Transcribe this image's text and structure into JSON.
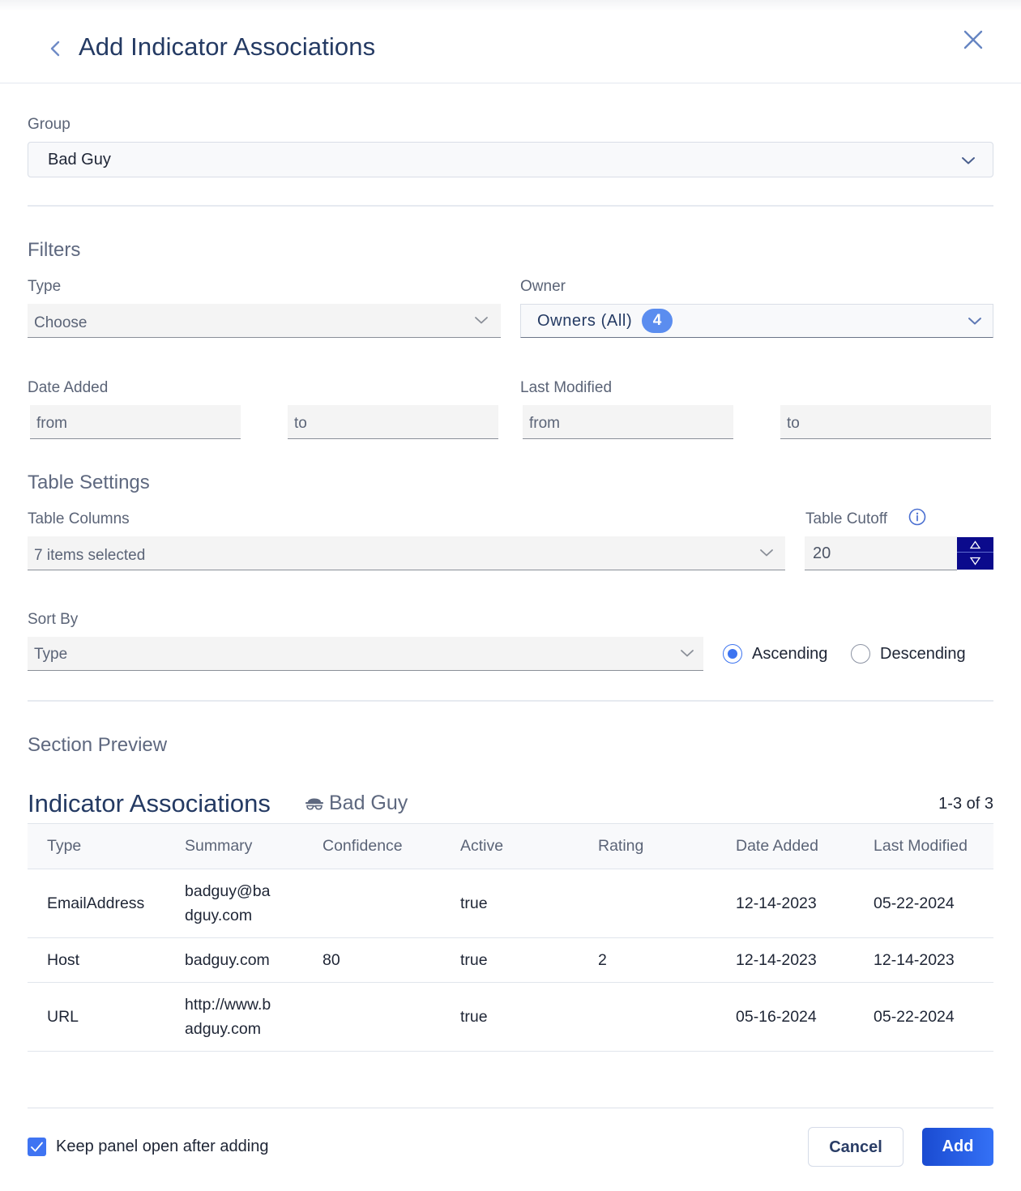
{
  "header": {
    "title": "Add Indicator Associations",
    "back_icon": "chevron-left-icon",
    "close_icon": "close-icon"
  },
  "group": {
    "label": "Group",
    "value": "Bad Guy"
  },
  "filters": {
    "title": "Filters",
    "type": {
      "label": "Type",
      "value": "Choose"
    },
    "owner": {
      "label": "Owner",
      "value": "Owners (All)",
      "count": "4"
    },
    "date_added": {
      "label": "Date Added",
      "from_placeholder": "from",
      "to_placeholder": "to"
    },
    "last_modified": {
      "label": "Last Modified",
      "from_placeholder": "from",
      "to_placeholder": "to"
    }
  },
  "table_settings": {
    "title": "Table Settings",
    "columns": {
      "label": "Table Columns",
      "value": "7 items selected"
    },
    "cutoff": {
      "label": "Table Cutoff",
      "value": "20",
      "info_icon": "info-icon"
    },
    "sort_by": {
      "label": "Sort By",
      "value": "Type"
    },
    "order": {
      "options": [
        "Ascending",
        "Descending"
      ],
      "selected": "Ascending"
    }
  },
  "preview": {
    "section_title": "Section Preview",
    "title": "Indicator Associations",
    "group_name": "Bad Guy",
    "group_icon": "spy-hat-icon",
    "pager": "1-3 of 3",
    "columns": [
      "Type",
      "Summary",
      "Confidence",
      "Active",
      "Rating",
      "Date Added",
      "Last Modified"
    ],
    "rows": [
      {
        "type": "EmailAddress",
        "summary": "badguy@badguy.com",
        "confidence": "",
        "active": "true",
        "rating": "",
        "date_added": "12-14-2023",
        "last_modified": "05-22-2024"
      },
      {
        "type": "Host",
        "summary": "badguy.com",
        "confidence": "80",
        "active": "true",
        "rating": "2",
        "date_added": "12-14-2023",
        "last_modified": "12-14-2023"
      },
      {
        "type": "URL",
        "summary": "http://www.badguy.com",
        "confidence": "",
        "active": "true",
        "rating": "",
        "date_added": "05-16-2024",
        "last_modified": "05-22-2024"
      }
    ]
  },
  "footer": {
    "keep_open_label": "Keep panel open after adding",
    "keep_open_checked": true,
    "cancel_label": "Cancel",
    "add_label": "Add"
  },
  "colors": {
    "accent": "#3d74f0",
    "title": "#243a63",
    "stepper": "#0b0a8c",
    "badge": "#5b8def"
  }
}
